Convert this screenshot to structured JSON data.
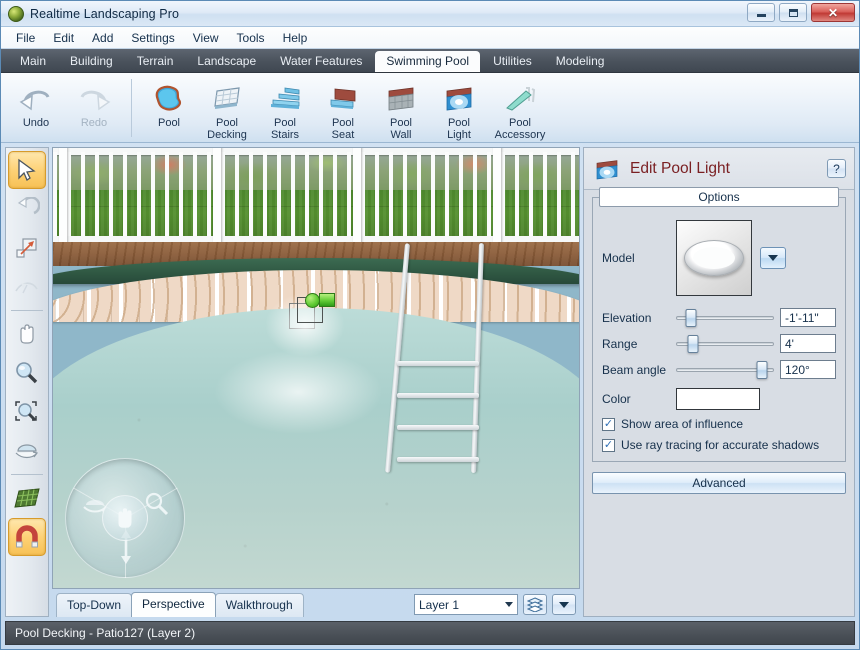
{
  "window": {
    "title": "Realtime Landscaping Pro",
    "app_icon": "globe-icon",
    "minimize_label": "—",
    "maximize_label": "□",
    "close_label": "✕"
  },
  "menu": {
    "items": [
      "File",
      "Edit",
      "Add",
      "Settings",
      "View",
      "Tools",
      "Help"
    ]
  },
  "ribbon_tabs": {
    "items": [
      "Main",
      "Building",
      "Terrain",
      "Landscape",
      "Water Features",
      "Swimming Pool",
      "Utilities",
      "Modeling"
    ],
    "active": "Swimming Pool"
  },
  "toolbar": {
    "history": [
      {
        "label": "Undo",
        "icon": "undo-arrow-icon",
        "enabled": true
      },
      {
        "label": "Redo",
        "icon": "redo-arrow-icon",
        "enabled": false
      }
    ],
    "tools": [
      {
        "label": "Pool",
        "icon": "pool-shape-icon"
      },
      {
        "label": "Pool\nDecking",
        "icon": "pool-decking-icon"
      },
      {
        "label": "Pool\nStairs",
        "icon": "pool-stairs-icon"
      },
      {
        "label": "Pool\nSeat",
        "icon": "pool-seat-icon"
      },
      {
        "label": "Pool\nWall",
        "icon": "pool-wall-icon"
      },
      {
        "label": "Pool\nLight",
        "icon": "pool-light-icon"
      },
      {
        "label": "Pool\nAccessory",
        "icon": "pool-accessory-icon"
      }
    ]
  },
  "left_tools": [
    {
      "name": "select-arrow-tool",
      "icon": "arrow-cursor-icon",
      "selected": true,
      "enabled": true
    },
    {
      "name": "rotate-tool",
      "icon": "rotate-arrow-icon",
      "selected": false,
      "enabled": true
    },
    {
      "name": "resize-tool",
      "icon": "resize-square-icon",
      "selected": false,
      "enabled": true
    },
    {
      "name": "curve-tool",
      "icon": "curve-arc-icon",
      "selected": false,
      "enabled": false
    },
    {
      "name": "pan-tool",
      "icon": "hand-icon",
      "selected": false,
      "enabled": true
    },
    {
      "name": "zoom-tool",
      "icon": "magnifier-icon",
      "selected": false,
      "enabled": true
    },
    {
      "name": "zoom-region-tool",
      "icon": "magnifier-region-icon",
      "selected": false,
      "enabled": true
    },
    {
      "name": "orbit-tool",
      "icon": "orbit-icon",
      "selected": false,
      "enabled": true
    },
    {
      "name": "grid-tool",
      "icon": "grid-icon",
      "selected": false,
      "enabled": true
    },
    {
      "name": "snap-magnet-tool",
      "icon": "magnet-icon",
      "selected": true,
      "enabled": true
    }
  ],
  "viewport": {
    "nav_wheel": {
      "center_icon": "hand-icon",
      "segments": [
        "orbit-icon",
        "magnifier-icon",
        "up-down-arrow-icon"
      ]
    },
    "selection_gizmo": "selected-pool-light-handles"
  },
  "view_tabs": {
    "items": [
      "Top-Down",
      "Perspective",
      "Walkthrough"
    ],
    "active": "Perspective"
  },
  "layer_control": {
    "value": "Layer 1",
    "layers_button_icon": "layers-stack-icon",
    "dropdown_button_icon": "chevron-down-icon"
  },
  "panel": {
    "title": "Edit Pool Light",
    "title_icon": "pool-light-icon",
    "help_label": "?",
    "group_title": "Options",
    "model": {
      "label": "Model",
      "thumbnail_icon": "recessed-ring-light-icon",
      "dropdown_icon": "chevron-down-icon"
    },
    "sliders": [
      {
        "label": "Elevation",
        "value": "-1'-11\"",
        "percent": 15
      },
      {
        "label": "Range",
        "value": "4'",
        "percent": 17
      },
      {
        "label": "Beam angle",
        "value": "120°",
        "percent": 88
      }
    ],
    "color": {
      "label": "Color",
      "value": "#ffffff"
    },
    "checkboxes": [
      {
        "label": "Show area of influence",
        "checked": true
      },
      {
        "label": "Use ray tracing for accurate shadows",
        "checked": true
      }
    ],
    "advanced_label": "Advanced"
  },
  "statusbar": {
    "text": "Pool Decking - Patio127 (Layer 2)"
  },
  "colors": {
    "title_accent": "#7a1f22",
    "tab_active_bg": "#fbfcfd",
    "selection_highlight": "#f7c155",
    "close_button": "#c03a35"
  }
}
